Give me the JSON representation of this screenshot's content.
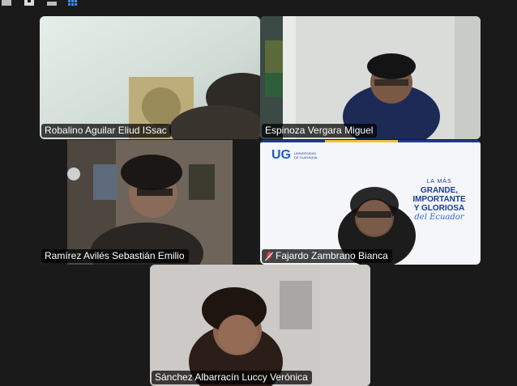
{
  "toolbar": {
    "view_buttons": [
      "speaker-view",
      "gallery-view-1",
      "gallery-view-2",
      "grid-view"
    ]
  },
  "participants": [
    {
      "name": "Robalino Aguilar Eliud ISsac",
      "muted": false,
      "active_speaker": false
    },
    {
      "name": "Espinoza Vergara Miguel",
      "muted": false,
      "active_speaker": false
    },
    {
      "name": "Ramírez Avilés Sebastián Emilio",
      "muted": false,
      "active_speaker": true
    },
    {
      "name": "Fajardo Zambrano Bianca",
      "muted": true,
      "active_speaker": false
    },
    {
      "name": "Sánchez Albarracín Luccy Verónica",
      "muted": false,
      "active_speaker": false
    }
  ],
  "background_banner": {
    "logo_text": "UG",
    "logo_sub": "UNIVERSIDAD DE GUAYAQUIL",
    "line1": "LA MÁS",
    "line2": "GRANDE,",
    "line3": "IMPORTANTE",
    "line4": "Y GLORIOSA",
    "line5": "del Ecuador"
  },
  "colors": {
    "active_border": "#4fd39a",
    "muted_icon": "#e0443e",
    "banner_blue": "#1d3b8f",
    "app_background": "#1a1a1a"
  }
}
